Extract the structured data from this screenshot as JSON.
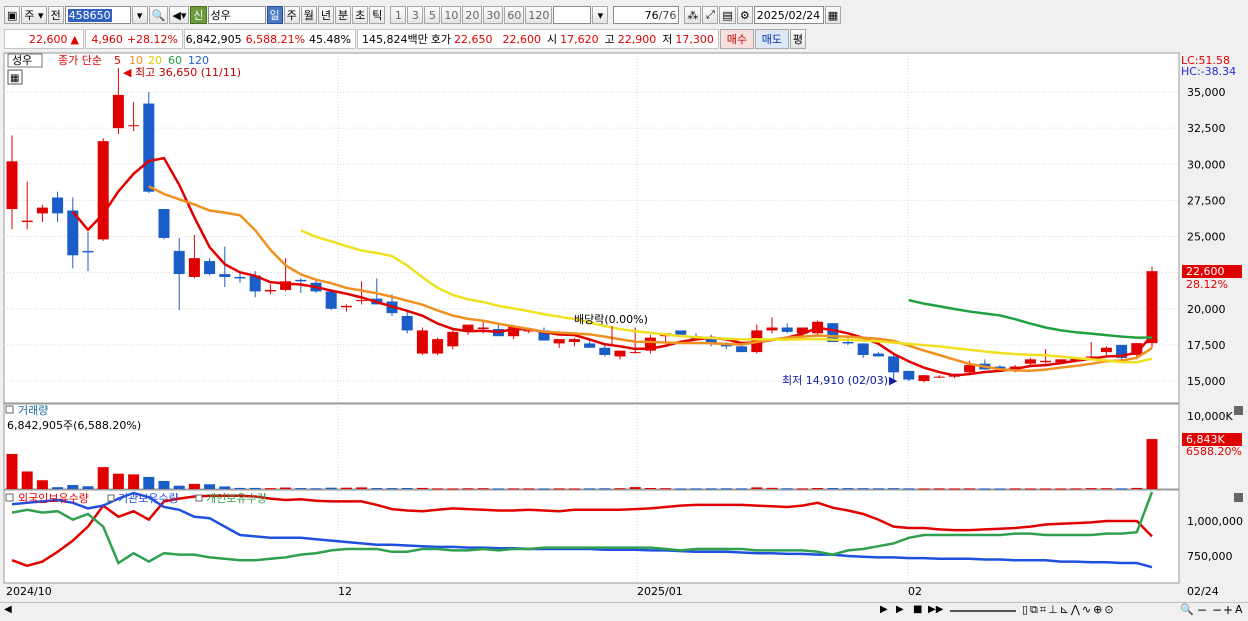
{
  "toolbar": {
    "market": "주",
    "all": "전",
    "code": "458650",
    "credit_badge": "신",
    "stock_name": "성우",
    "periods": [
      "일",
      "주",
      "월",
      "년",
      "분",
      "초",
      "틱"
    ],
    "minutes": [
      "1",
      "3",
      "5",
      "10",
      "20",
      "30",
      "60",
      "120"
    ],
    "count": "76",
    "count_total": "/76",
    "date": "2025/02/24"
  },
  "quote": {
    "price": "22,600",
    "change": "4,960",
    "change_pct": "+28.12%",
    "volume": "6,842,905",
    "volume_ratio": "6,588.21%",
    "turnover": "45.48%",
    "amount": "145,824백만",
    "ask_label": "호가",
    "ask": "22,650",
    "bid": "22,600",
    "open_label": "시",
    "open": "17,620",
    "high_label": "고",
    "high": "22,900",
    "low_label": "저",
    "low": "17,300",
    "buy_label": "매수",
    "sell_label": "매도",
    "avg_label": "평"
  },
  "price_panel": {
    "name_tag": "성우",
    "legend_prefix": "종가 단순",
    "ma_periods": [
      "5",
      "10",
      "20",
      "60",
      "120"
    ],
    "ma_colors": [
      "#e00000",
      "#f09020",
      "#f0e020",
      "#20a040",
      "#2060d0"
    ],
    "high_annotation": "최고 36,650 (11/11)",
    "low_annotation": "최저 14,910 (02/03)",
    "dividend_annotation": "배당락(0.00%)",
    "lc": "LC:51.58",
    "hc": "HC:-38.34",
    "y_ticks": [
      "35,000",
      "32,500",
      "30,000",
      "27,500",
      "25,000",
      "22,500",
      "20,000",
      "17,500",
      "15,000"
    ],
    "last_price_tag": "22,600",
    "last_pct_tag": "28.12%"
  },
  "volume_panel": {
    "title": "거래량",
    "info": "6,842,905주(6,588.20%)",
    "y_ticks": [
      "10,000K"
    ],
    "last_tag": "6,843K",
    "last_pct_tag": "6588.20%"
  },
  "holdings_panel": {
    "legend": [
      "외국인보유수량",
      "기관보유수량",
      "개인보유수량"
    ],
    "legend_colors": [
      "#e00000",
      "#2050e0",
      "#30a050"
    ],
    "y_ticks": [
      "1,000,000",
      "750,000"
    ]
  },
  "x_axis": [
    "2024/10",
    "12",
    "2025/01",
    "02",
    "02/24"
  ],
  "chart_data": {
    "type": "candlestick",
    "candles": [
      [
        26900,
        32000,
        25500,
        30200
      ],
      [
        26000,
        28800,
        25500,
        26100
      ],
      [
        26600,
        27200,
        26000,
        27000
      ],
      [
        27700,
        28100,
        26000,
        26600
      ],
      [
        26800,
        27700,
        22800,
        23700
      ],
      [
        24000,
        25300,
        22600,
        23900
      ],
      [
        24800,
        31800,
        24700,
        31600
      ],
      [
        32500,
        36650,
        32100,
        34800
      ],
      [
        32700,
        34300,
        32300,
        32700
      ],
      [
        34200,
        35000,
        28000,
        28100
      ],
      [
        26900,
        26900,
        24800,
        24900
      ],
      [
        24000,
        24900,
        19900,
        22400
      ],
      [
        22200,
        25100,
        22100,
        23500
      ],
      [
        23300,
        23500,
        22300,
        22400
      ],
      [
        22400,
        24300,
        21500,
        22200
      ],
      [
        22200,
        22600,
        21800,
        22100
      ],
      [
        22300,
        22600,
        20800,
        21200
      ],
      [
        21200,
        21700,
        21000,
        21300
      ],
      [
        21300,
        23500,
        21200,
        21900
      ],
      [
        22000,
        22100,
        21100,
        21900
      ],
      [
        21800,
        22000,
        21100,
        21200
      ],
      [
        21200,
        21300,
        19900,
        20000
      ],
      [
        20100,
        20300,
        19800,
        20200
      ],
      [
        20600,
        21900,
        20300,
        20600
      ],
      [
        20700,
        22100,
        20300,
        20300
      ],
      [
        20500,
        21000,
        19500,
        19700
      ],
      [
        19500,
        19800,
        18300,
        18500
      ],
      [
        16900,
        18700,
        16800,
        18500
      ],
      [
        16900,
        18000,
        16800,
        17900
      ],
      [
        17400,
        18500,
        17200,
        18400
      ],
      [
        18400,
        18800,
        18200,
        18900
      ],
      [
        18600,
        19100,
        18300,
        18700
      ],
      [
        18600,
        19000,
        18200,
        18100
      ],
      [
        18100,
        18800,
        17900,
        18800
      ],
      [
        18500,
        18600,
        18300,
        18500
      ],
      [
        18500,
        18700,
        18100,
        17800
      ],
      [
        17600,
        17800,
        17300,
        17900
      ],
      [
        17700,
        18000,
        17400,
        17900
      ],
      [
        17600,
        17900,
        17300,
        17300
      ],
      [
        17300,
        17600,
        16700,
        16800
      ],
      [
        16700,
        17100,
        16500,
        17100
      ],
      [
        17000,
        18700,
        16900,
        17000
      ],
      [
        17100,
        18200,
        16900,
        18000
      ],
      [
        18100,
        18300,
        17700,
        18300
      ],
      [
        18500,
        18500,
        18100,
        18200
      ],
      [
        18100,
        18300,
        17800,
        17900
      ],
      [
        18000,
        18200,
        17400,
        17600
      ],
      [
        17600,
        17700,
        17200,
        17400
      ],
      [
        17400,
        17500,
        17000,
        17000
      ],
      [
        17000,
        18900,
        16900,
        18500
      ],
      [
        18500,
        19400,
        18300,
        18700
      ],
      [
        18700,
        19000,
        18300,
        18400
      ],
      [
        18300,
        18600,
        18000,
        18700
      ],
      [
        18300,
        19200,
        18100,
        19100
      ],
      [
        19000,
        19000,
        17800,
        17700
      ],
      [
        17700,
        18100,
        17500,
        17600
      ],
      [
        17600,
        17600,
        16600,
        16800
      ],
      [
        16900,
        17000,
        16700,
        16700
      ],
      [
        16700,
        16800,
        14910,
        15600
      ],
      [
        15700,
        15700,
        15000,
        15100
      ],
      [
        15000,
        15400,
        14900,
        15400
      ],
      [
        15300,
        15400,
        15200,
        15300
      ],
      [
        15300,
        15500,
        15200,
        15500
      ],
      [
        15600,
        16400,
        15400,
        16100
      ],
      [
        16200,
        16500,
        15800,
        15800
      ],
      [
        16000,
        16100,
        15800,
        15800
      ],
      [
        15800,
        16100,
        15600,
        16000
      ],
      [
        16200,
        16600,
        16100,
        16500
      ],
      [
        16300,
        17200,
        16200,
        16400
      ],
      [
        16300,
        16500,
        16200,
        16500
      ],
      [
        16400,
        16500,
        16300,
        16600
      ],
      [
        16700,
        17700,
        16600,
        16700
      ],
      [
        17000,
        17400,
        16800,
        17300
      ],
      [
        17500,
        17500,
        16300,
        16600
      ],
      [
        16800,
        17600,
        16500,
        17620
      ],
      [
        17620,
        22900,
        17300,
        22600
      ]
    ],
    "volume_k": [
      4800,
      2400,
      1200,
      250,
      550,
      380,
      3000,
      2100,
      2000,
      1650,
      1100,
      450,
      700,
      650,
      350,
      150,
      150,
      120,
      200,
      130,
      100,
      180,
      180,
      220,
      130,
      120,
      140,
      150,
      90,
      80,
      100,
      110,
      80,
      90,
      90,
      80,
      90,
      80,
      90,
      100,
      110,
      260,
      140,
      110,
      80,
      90,
      90,
      100,
      90,
      220,
      160,
      100,
      90,
      140,
      130,
      120,
      110,
      100,
      120,
      90,
      80,
      90,
      80,
      90,
      80,
      80,
      90,
      80,
      80,
      80,
      90,
      120,
      110,
      90,
      150,
      6843
    ],
    "foreign": [
      720,
      680,
      710,
      780,
      860,
      960,
      1110,
      1030,
      1070,
      1010,
      1140,
      1160,
      1175,
      1180,
      1180,
      1180,
      1175,
      1160,
      1150,
      1155,
      1145,
      1140,
      1140,
      1140,
      1115,
      1085,
      1075,
      1070,
      1080,
      1090,
      1085,
      1080,
      1075,
      1075,
      1080,
      1075,
      1070,
      1080,
      1080,
      1080,
      1080,
      1085,
      1090,
      1100,
      1110,
      1115,
      1115,
      1115,
      1115,
      1110,
      1105,
      1100,
      1110,
      1130,
      1095,
      1075,
      1050,
      1010,
      960,
      950,
      950,
      940,
      935,
      935,
      940,
      945,
      950,
      960,
      975,
      980,
      985,
      990,
      1000,
      1000,
      1000,
      890
    ],
    "institution": [
      1120,
      1130,
      1140,
      1150,
      1130,
      1090,
      1110,
      1160,
      1200,
      1170,
      1100,
      1080,
      1030,
      1020,
      960,
      900,
      890,
      880,
      880,
      880,
      870,
      860,
      850,
      840,
      830,
      830,
      825,
      820,
      815,
      815,
      810,
      810,
      805,
      805,
      800,
      800,
      800,
      800,
      800,
      795,
      795,
      795,
      790,
      790,
      785,
      780,
      780,
      780,
      775,
      770,
      770,
      765,
      765,
      760,
      760,
      750,
      745,
      740,
      740,
      735,
      735,
      730,
      730,
      730,
      725,
      725,
      720,
      720,
      720,
      710,
      710,
      705,
      705,
      700,
      700,
      670
    ],
    "individual": [
      1060,
      1080,
      1060,
      1070,
      1010,
      1050,
      960,
      700,
      770,
      710,
      770,
      760,
      760,
      740,
      730,
      720,
      720,
      730,
      740,
      760,
      770,
      790,
      800,
      800,
      800,
      780,
      780,
      800,
      800,
      790,
      790,
      800,
      790,
      800,
      800,
      810,
      810,
      810,
      810,
      810,
      810,
      810,
      810,
      800,
      790,
      800,
      800,
      800,
      800,
      790,
      790,
      790,
      790,
      780,
      760,
      790,
      800,
      820,
      840,
      880,
      900,
      900,
      900,
      900,
      900,
      900,
      910,
      910,
      900,
      900,
      900,
      900,
      910,
      910,
      920,
      1250
    ]
  }
}
